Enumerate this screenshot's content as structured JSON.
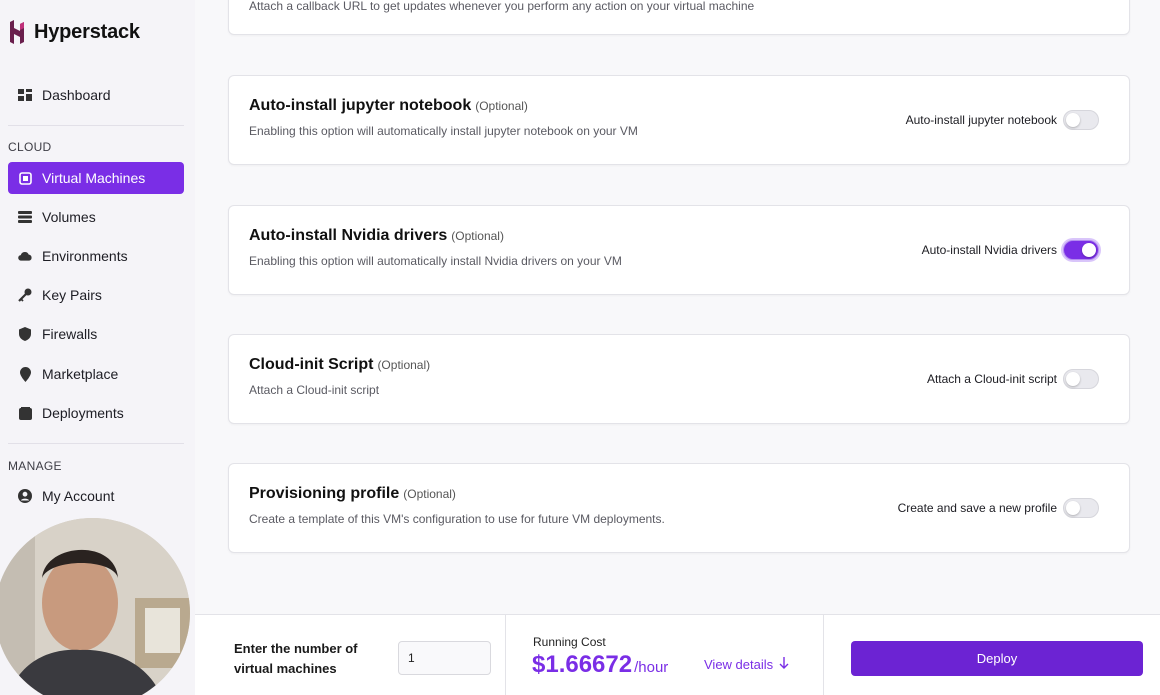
{
  "brand": {
    "name": "Hyperstack"
  },
  "sidebar": {
    "dashboard": "Dashboard",
    "cloud_label": "CLOUD",
    "items": [
      {
        "label": "Virtual Machines",
        "icon": "chip-icon"
      },
      {
        "label": "Volumes",
        "icon": "database-icon"
      },
      {
        "label": "Environments",
        "icon": "cloud-icon"
      },
      {
        "label": "Key Pairs",
        "icon": "key-icon"
      },
      {
        "label": "Firewalls",
        "icon": "shield-icon"
      },
      {
        "label": "Marketplace",
        "icon": "map-pin-icon"
      },
      {
        "label": "Deployments",
        "icon": "stack-icon"
      }
    ],
    "manage_label": "MANAGE",
    "my_account": "My Account"
  },
  "cards": {
    "top_partial": "Attach a callback URL to get updates whenever you perform any action on your virtual machine",
    "jupyter": {
      "title": "Auto-install jupyter notebook",
      "optional": "(Optional)",
      "desc": "Enabling this option will automatically install jupyter notebook on your VM",
      "toggle_label": "Auto-install jupyter notebook",
      "enabled": false
    },
    "nvidia": {
      "title": "Auto-install Nvidia drivers",
      "optional": "(Optional)",
      "desc": "Enabling this option will automatically install Nvidia drivers on your VM",
      "toggle_label": "Auto-install Nvidia drivers",
      "enabled": true
    },
    "cloudinit": {
      "title": "Cloud-init Script",
      "optional": "(Optional)",
      "desc": "Attach a Cloud-init script",
      "toggle_label": "Attach a Cloud-init script",
      "enabled": false
    },
    "profile": {
      "title": "Provisioning profile",
      "optional": "(Optional)",
      "desc": "Create a template of this VM's configuration to use for future VM deployments.",
      "toggle_label": "Create and save a new profile",
      "enabled": false
    }
  },
  "footer": {
    "vm_count_label": "Enter the number of virtual machines",
    "vm_count_value": "1",
    "running_cost_label": "Running Cost",
    "running_cost_value": "$1.66672",
    "running_cost_unit": "/hour",
    "view_details": "View details",
    "deploy": "Deploy"
  },
  "colors": {
    "accent": "#7a2ee6",
    "deploy": "#6c23d3"
  }
}
